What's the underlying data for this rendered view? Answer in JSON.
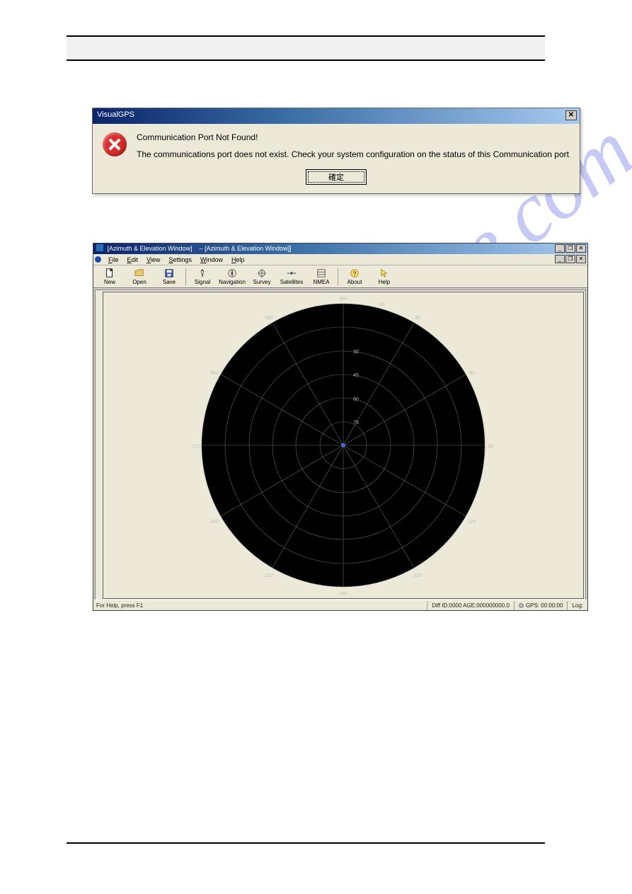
{
  "watermark": "manualslive.com",
  "error_dialog": {
    "title": "VisualGPS",
    "close": "✕",
    "heading": "Communication Port Not Found!",
    "body": "The communications port does not exist. Check your system configuration on the status of this Communication port",
    "ok_label": "確定"
  },
  "app": {
    "title_prefix": "[Azimuth & Elevation Window]",
    "title_suffix": "– [Azimuth & Elevation Window]]",
    "minimize": "_",
    "restore": "❐",
    "close": "✕",
    "menu": {
      "file": "File",
      "edit": "Edit",
      "view": "View",
      "settings": "Settings",
      "window": "Window",
      "help": "Help"
    },
    "toolbar": {
      "new": "New",
      "open": "Open",
      "save": "Save",
      "signal": "Signal",
      "navigation": "Navigation",
      "survey": "Survey",
      "satellites": "Satellites",
      "nmea": "NMEA",
      "about": "About",
      "help": "Help"
    },
    "radar": {
      "azimuth_ticks": [
        "360",
        "15",
        "30",
        "60",
        "90",
        "120",
        "150",
        "180",
        "210",
        "240",
        "270",
        "300",
        "330"
      ],
      "elevation_rings": [
        "75",
        "60",
        "45",
        "30"
      ]
    },
    "status": {
      "help": "For Help, press F1",
      "diff": "Diff ID:0000 AGE:000000000.0",
      "gps": "GPS: 00:00:00",
      "log": "Log:"
    }
  }
}
